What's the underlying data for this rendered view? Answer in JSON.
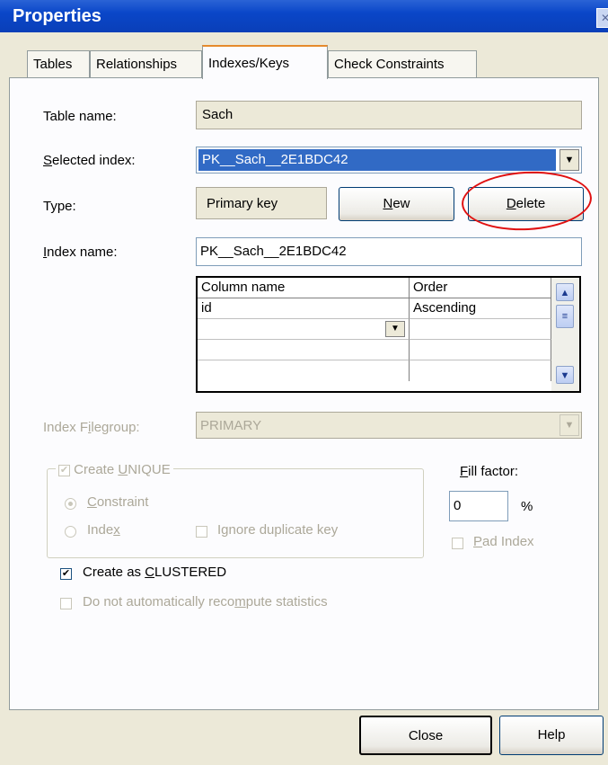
{
  "window": {
    "title": "Properties"
  },
  "tabs": [
    {
      "label": "Tables",
      "active": false
    },
    {
      "label": "Relationships",
      "active": false
    },
    {
      "label": "Indexes/Keys",
      "active": true
    },
    {
      "label": "Check Constraints",
      "active": false
    }
  ],
  "form": {
    "table_name_label": "Table name:",
    "table_name_value": "Sach",
    "selected_index_label": "Selected index:",
    "selected_index_value": "PK__Sach__2E1BDC42",
    "type_label": "Type:",
    "type_value": "Primary key",
    "new_button": "New",
    "delete_button": "Delete",
    "index_name_label": "Index name:",
    "index_name_value": "PK__Sach__2E1BDC42"
  },
  "columns_grid": {
    "headers": [
      "Column name",
      "Order"
    ],
    "rows": [
      {
        "column": "id",
        "order": "Ascending"
      }
    ]
  },
  "filegroup": {
    "label": "Index Filegroup:",
    "value": "PRIMARY"
  },
  "unique": {
    "create_unique_label": "Create UNIQUE",
    "create_unique_checked": true,
    "constraint_label": "Constraint",
    "constraint_selected": true,
    "index_label": "Index",
    "ignore_duplicate_label": "Ignore duplicate key"
  },
  "fill": {
    "fill_factor_label": "Fill factor:",
    "fill_factor_value": "0",
    "percent_sign": "%",
    "pad_index_label": "Pad Index"
  },
  "options": {
    "create_clustered_label": "Create as CLUSTERED",
    "create_clustered_checked": true,
    "no_recompute_label": "Do not automatically recompute statistics"
  },
  "footer": {
    "close_button": "Close",
    "help_button": "Help"
  },
  "colors": {
    "titlebar": "#0a46c8",
    "selection": "#316ac5",
    "highlight_annotation": "#e01010"
  }
}
